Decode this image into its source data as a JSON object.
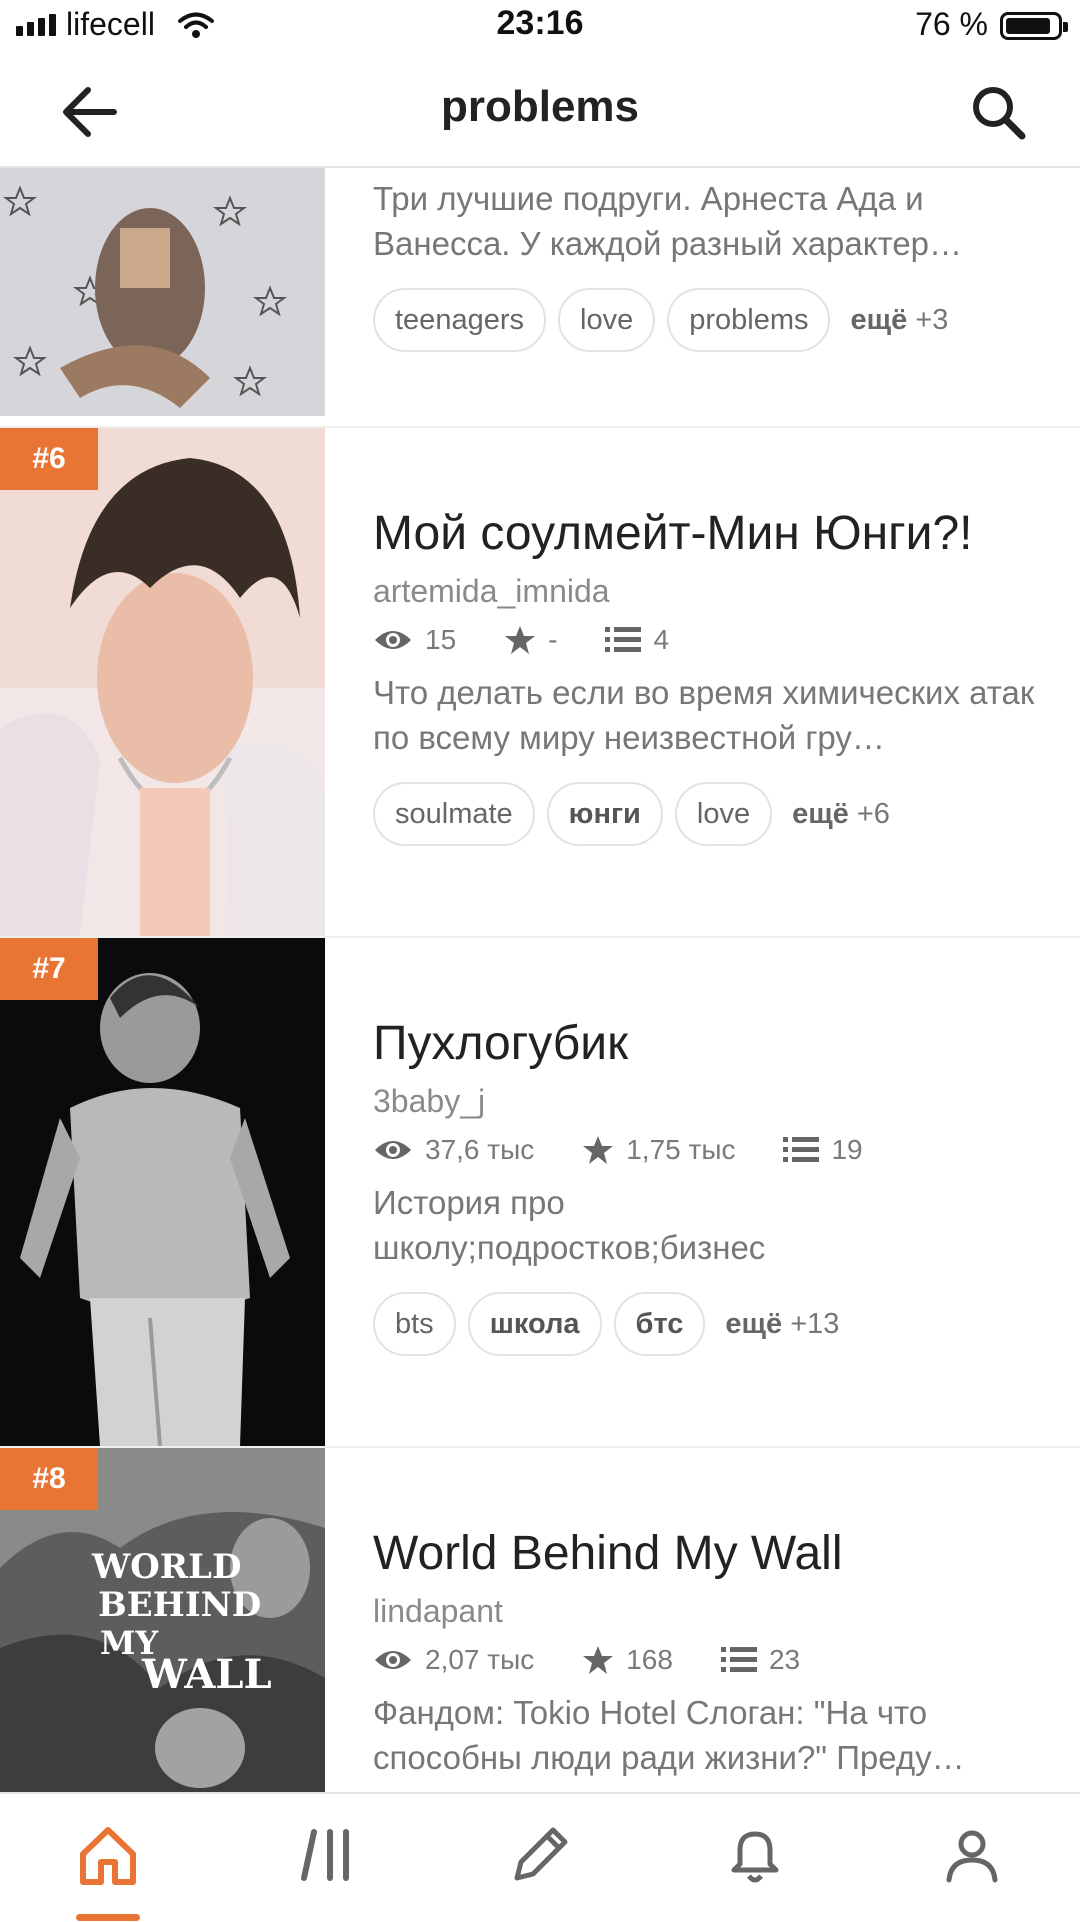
{
  "status_bar": {
    "carrier": "lifecell",
    "time": "23:16",
    "battery": "76 %"
  },
  "header": {
    "title": "problems"
  },
  "items": [
    {
      "rank": "",
      "desc": "Три лучшие подруги. Арнеста Ада и Ванесса. У каждой разный характер…",
      "tags": [
        "teenagers",
        "love",
        "problems"
      ],
      "more_label": "ещё",
      "more_count": "+3"
    },
    {
      "rank": "#6",
      "title": "Мой соулмейт-Мин Юнги?!",
      "author": "artemida_imnida",
      "views": "15",
      "stars": "-",
      "chapters": "4",
      "desc": "Что делать если во время химических атак по всему миру неизвестной гру…",
      "tags": [
        "soulmate",
        "юнги",
        "love"
      ],
      "more_label": "ещё",
      "more_count": "+6"
    },
    {
      "rank": "#7",
      "title": "Пухлогубик",
      "author": "3baby_j",
      "views": "37,6 тыс",
      "stars": "1,75 тыс",
      "chapters": "19",
      "desc": "История про школу;подростков;бизнес",
      "tags": [
        "bts",
        "школа",
        "бтс"
      ],
      "more_label": "ещё",
      "more_count": "+13"
    },
    {
      "rank": "#8",
      "title": "World Behind My Wall",
      "author": "lindapant",
      "views": "2,07 тыс",
      "stars": "168",
      "chapters": "23",
      "desc": "Фандом: Tokio Hotel Слоган: \"На что способны люди ради жизни?\" Преду…",
      "cover_text": [
        "WORLD",
        "BEHIND",
        "MY",
        "WALL"
      ]
    }
  ],
  "bottom_nav": [
    "home-icon",
    "library-icon",
    "write-icon",
    "notifications-icon",
    "profile-icon"
  ],
  "colors": {
    "accent": "#e87534",
    "icon_grey": "#666666"
  }
}
